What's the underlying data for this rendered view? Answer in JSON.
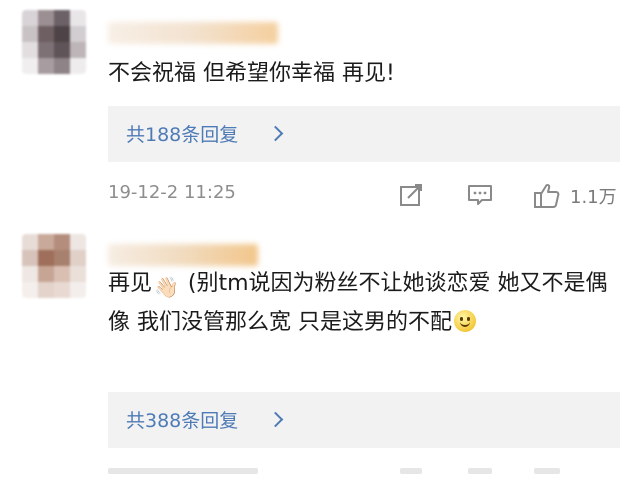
{
  "comments": [
    {
      "text": "不会祝福 但希望你幸福 再见!",
      "replies_label": "共188条回复",
      "timestamp": "19-12-2 11:25",
      "likes": "1.1万"
    },
    {
      "text_before_emoji": "再见",
      "emoji_wave": "👋🏻",
      "text_after_emoji": " (别tm说因为粉丝不让她谈恋爱 她又不是偶像 我们没管那么宽 只是这男的不配",
      "emoji_smile": "smile-emoji",
      "replies_label": "共388条回复"
    }
  ],
  "icons": {
    "edit": "edit-icon",
    "comment": "comment-icon",
    "like": "thumbs-up-icon",
    "chevron": "chevron-right-icon"
  },
  "colors": {
    "link": "#4e7bb6",
    "reply_bg": "#f2f2f2",
    "meta": "#8d8d8d"
  }
}
